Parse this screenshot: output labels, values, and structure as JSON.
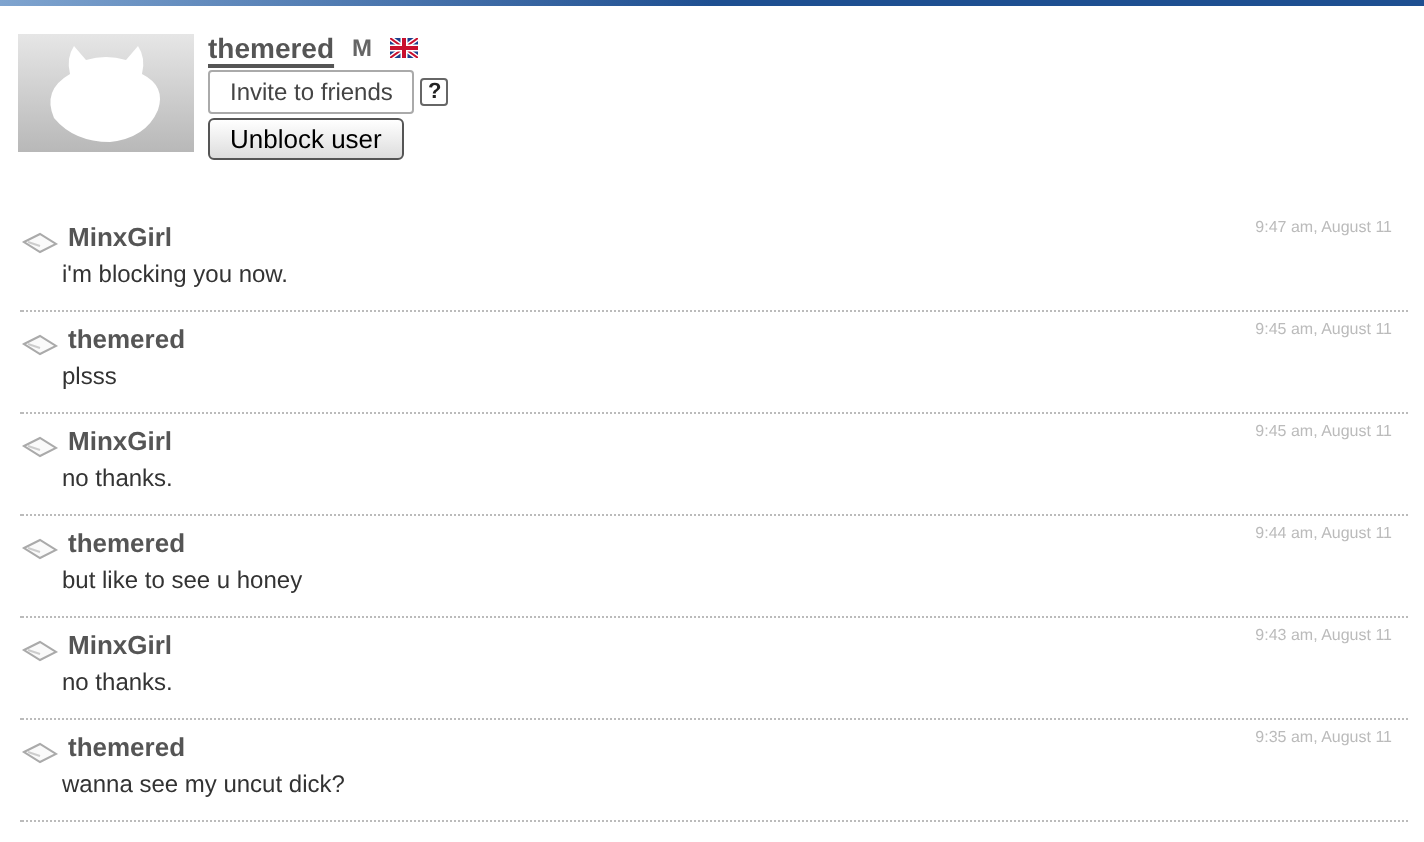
{
  "profile": {
    "username": "themered",
    "gender": "M",
    "invite_button": "Invite to friends",
    "help": "?",
    "unblock_button": "Unblock user"
  },
  "messages": [
    {
      "sender": "MinxGirl",
      "text": "i'm blocking you now.",
      "time": "9:47 am, August 11"
    },
    {
      "sender": "themered",
      "text": "plsss",
      "time": "9:45 am, August 11"
    },
    {
      "sender": "MinxGirl",
      "text": "no thanks.",
      "time": "9:45 am, August 11"
    },
    {
      "sender": "themered",
      "text": "but like to see u honey",
      "time": "9:44 am, August 11"
    },
    {
      "sender": "MinxGirl",
      "text": "no thanks.",
      "time": "9:43 am, August 11"
    },
    {
      "sender": "themered",
      "text": "wanna see my uncut dick?",
      "time": "9:35 am, August 11"
    }
  ]
}
